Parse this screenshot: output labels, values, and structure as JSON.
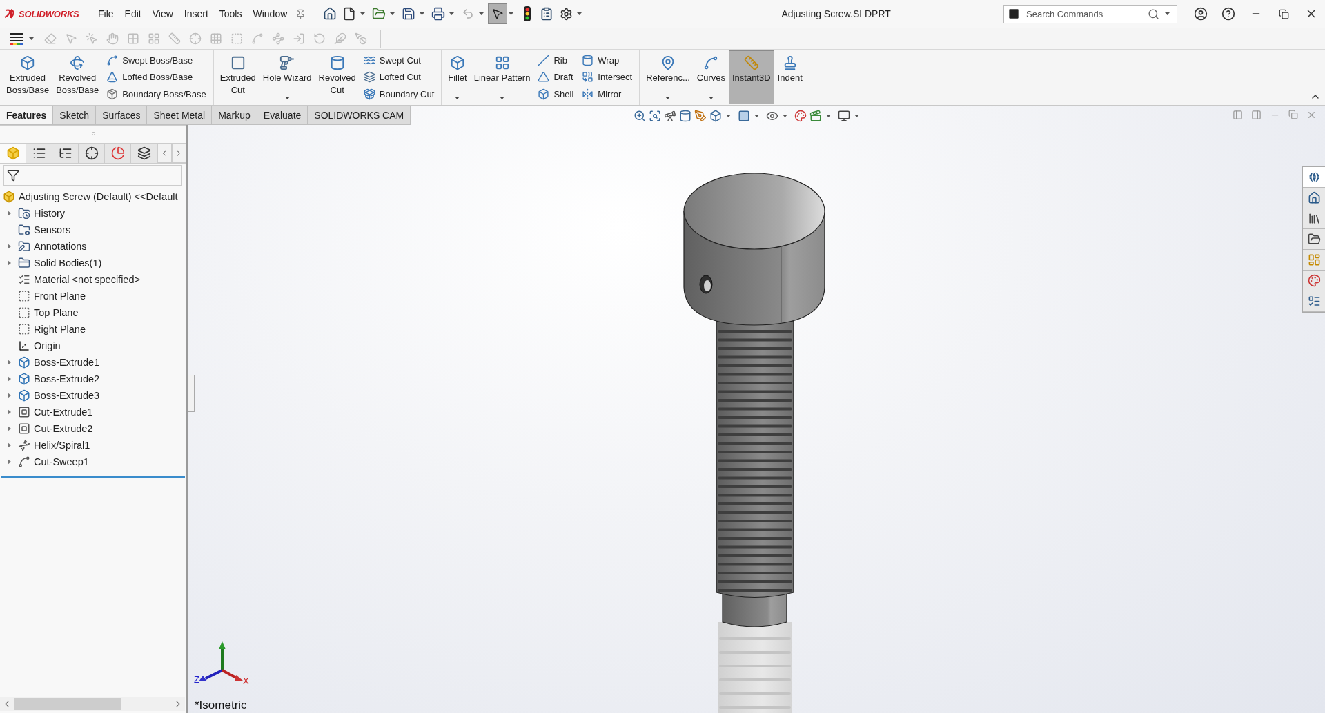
{
  "title_bar": {
    "logo": "SOLIDWORKS",
    "menu": [
      "File",
      "Edit",
      "View",
      "Insert",
      "Tools",
      "Window"
    ],
    "title": "Adjusting Screw.SLDPRT",
    "search": {
      "placeholder": "Search Commands"
    }
  },
  "ribbon": {
    "groups": [
      {
        "items": [
          {
            "kind": "large",
            "label": "Extruded\nBoss/Base",
            "dropdown": false,
            "pressed": false
          },
          {
            "kind": "large",
            "label": "Revolved\nBoss/Base",
            "dropdown": false,
            "pressed": false
          },
          {
            "kind": "stack",
            "entries": [
              "Swept Boss/Base",
              "Lofted Boss/Base",
              "Boundary Boss/Base"
            ]
          }
        ]
      },
      {
        "items": [
          {
            "kind": "large",
            "label": "Extruded\nCut",
            "dropdown": false,
            "pressed": false
          },
          {
            "kind": "large",
            "label": "Hole Wizard",
            "dropdown": true,
            "pressed": false
          },
          {
            "kind": "large",
            "label": "Revolved\nCut",
            "dropdown": false,
            "pressed": false
          },
          {
            "kind": "stack",
            "entries": [
              "Swept Cut",
              "Lofted Cut",
              "Boundary Cut"
            ]
          }
        ]
      },
      {
        "items": [
          {
            "kind": "large",
            "label": "Fillet",
            "dropdown": true,
            "pressed": false
          },
          {
            "kind": "large",
            "label": "Linear Pattern",
            "dropdown": true,
            "pressed": false
          },
          {
            "kind": "stack",
            "entries": [
              "Rib",
              "Draft",
              "Shell"
            ]
          },
          {
            "kind": "stack",
            "entries": [
              "Wrap",
              "Intersect",
              "Mirror"
            ]
          }
        ]
      },
      {
        "items": [
          {
            "kind": "large",
            "label": "Referenc...",
            "dropdown": true,
            "pressed": false
          },
          {
            "kind": "large",
            "label": "Curves",
            "dropdown": true,
            "pressed": false
          },
          {
            "kind": "large",
            "label": "Instant3D",
            "dropdown": false,
            "pressed": true
          },
          {
            "kind": "large",
            "label": "Indent",
            "dropdown": false,
            "pressed": false
          }
        ]
      }
    ]
  },
  "tabs": [
    {
      "label": "Features",
      "selected": true
    },
    {
      "label": "Sketch",
      "selected": false
    },
    {
      "label": "Surfaces",
      "selected": false
    },
    {
      "label": "Sheet Metal",
      "selected": false
    },
    {
      "label": "Markup",
      "selected": false
    },
    {
      "label": "Evaluate",
      "selected": false
    },
    {
      "label": "SOLIDWORKS CAM",
      "selected": false
    }
  ],
  "feature_tree": {
    "panel_tabs": [
      {
        "selected": true
      },
      {
        "selected": false
      },
      {
        "selected": false
      },
      {
        "selected": false
      },
      {
        "selected": false
      },
      {
        "selected": false
      }
    ],
    "root": "Adjusting Screw (Default) <<Default",
    "items": [
      {
        "label": "History",
        "kind": "history",
        "expandable": true
      },
      {
        "label": "Sensors",
        "kind": "sensors",
        "expandable": false
      },
      {
        "label": "Annotations",
        "kind": "annotations",
        "expandable": true
      },
      {
        "label": "Solid Bodies(1)",
        "kind": "bodies",
        "expandable": true
      },
      {
        "label": "Material <not specified>",
        "kind": "material",
        "expandable": false
      },
      {
        "label": "Front Plane",
        "kind": "plane",
        "expandable": false
      },
      {
        "label": "Top Plane",
        "kind": "plane",
        "expandable": false
      },
      {
        "label": "Right Plane",
        "kind": "plane",
        "expandable": false
      },
      {
        "label": "Origin",
        "kind": "origin",
        "expandable": false
      },
      {
        "label": "Boss-Extrude1",
        "kind": "boss",
        "expandable": true
      },
      {
        "label": "Boss-Extrude2",
        "kind": "boss",
        "expandable": true
      },
      {
        "label": "Boss-Extrude3",
        "kind": "boss",
        "expandable": true
      },
      {
        "label": "Cut-Extrude1",
        "kind": "cut",
        "expandable": true
      },
      {
        "label": "Cut-Extrude2",
        "kind": "cut",
        "expandable": true
      },
      {
        "label": "Helix/Spiral1",
        "kind": "helix",
        "expandable": true
      },
      {
        "label": "Cut-Sweep1",
        "kind": "sweep",
        "expandable": true
      }
    ]
  },
  "viewport": {
    "view_name": "*Isometric",
    "triad": {
      "x": "X",
      "z": "Z"
    },
    "task_pane": [
      {
        "selected": true
      },
      {
        "selected": false
      },
      {
        "selected": false
      },
      {
        "selected": false
      },
      {
        "selected": false
      },
      {
        "selected": false
      },
      {
        "selected": false
      }
    ]
  }
}
